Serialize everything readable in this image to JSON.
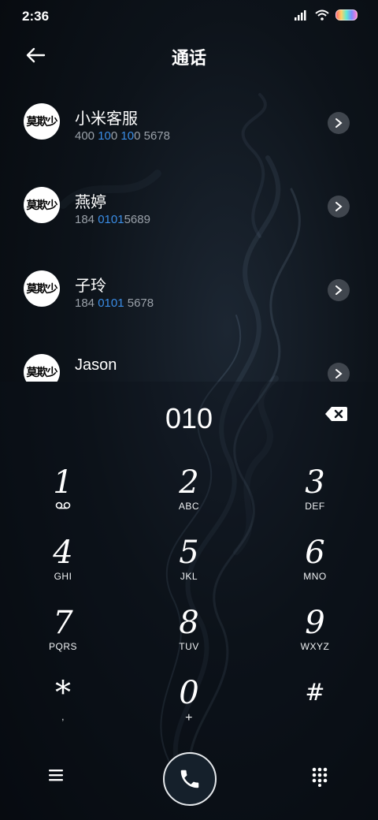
{
  "status_bar": {
    "time": "2:36"
  },
  "header": {
    "title": "通话"
  },
  "contacts": [
    {
      "name": "小米客服",
      "number_parts": [
        "400 ",
        "10",
        "0 ",
        "10",
        "0 5678"
      ],
      "avatar_text": "莫欺少年穷"
    },
    {
      "name": "燕婷",
      "number_parts": [
        "184 ",
        "010",
        "",
        "1",
        "5689"
      ],
      "avatar_text": "莫欺少年穷"
    },
    {
      "name": "子玲",
      "number_parts": [
        "184 ",
        "010",
        "",
        "1",
        " 5678"
      ],
      "avatar_text": "莫欺少年穷"
    },
    {
      "name": "Jason",
      "number_parts": [
        "",
        "",
        "",
        "",
        ""
      ],
      "avatar_text": "莫欺少年穷"
    }
  ],
  "dialer": {
    "input_value": "010",
    "keys": [
      {
        "digit": "1",
        "letters": ""
      },
      {
        "digit": "2",
        "letters": "ABC"
      },
      {
        "digit": "3",
        "letters": "DEF"
      },
      {
        "digit": "4",
        "letters": "GHI"
      },
      {
        "digit": "5",
        "letters": "JKL"
      },
      {
        "digit": "6",
        "letters": "MNO"
      },
      {
        "digit": "7",
        "letters": "PQRS"
      },
      {
        "digit": "8",
        "letters": "TUV"
      },
      {
        "digit": "9",
        "letters": "WXYZ"
      },
      {
        "digit": "*",
        "letters": ","
      },
      {
        "digit": "0",
        "letters": "+"
      },
      {
        "digit": "#",
        "letters": ""
      }
    ]
  },
  "icons": {
    "back": "arrow-left-icon",
    "detail": "chevron-right-icon",
    "backspace": "backspace-icon",
    "voicemail": "voicemail-icon",
    "menu": "menu-icon",
    "call": "phone-icon",
    "keypad": "keypad-icon"
  },
  "colors": {
    "highlight": "#3a8de6",
    "chevron_bg": "#40464e"
  }
}
